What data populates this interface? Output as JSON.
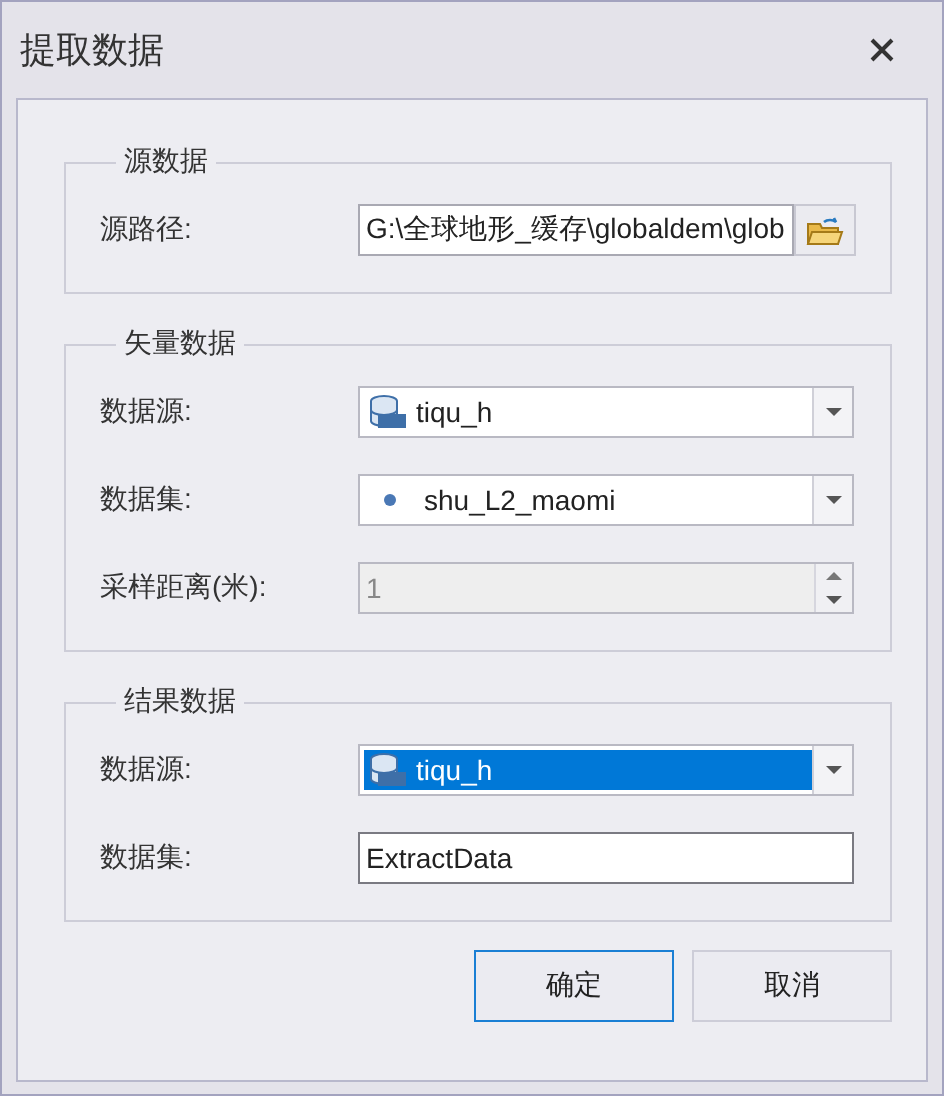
{
  "window": {
    "title": "提取数据"
  },
  "groups": [
    {
      "title": "源数据",
      "rows": [
        {
          "kind": "path",
          "label": "源路径:",
          "value": "G:\\全球地形_缓存\\globaldem\\glob"
        }
      ]
    },
    {
      "title": "矢量数据",
      "rows": [
        {
          "kind": "source",
          "label": "数据源:",
          "value": "tiqu_h",
          "highlighted": false
        },
        {
          "kind": "dataset",
          "label": "数据集:",
          "value": "shu_L2_maomi",
          "highlighted": false
        },
        {
          "kind": "spin",
          "label": "采样距离(米):",
          "value": "1",
          "disabled": true
        }
      ]
    },
    {
      "title": "结果数据",
      "rows": [
        {
          "kind": "source",
          "label": "数据源:",
          "value": "tiqu_h",
          "highlighted": true
        },
        {
          "kind": "text",
          "label": "数据集:",
          "value": "ExtractData"
        }
      ]
    }
  ],
  "buttons": [
    {
      "label": "确定",
      "default": true
    },
    {
      "label": "取消",
      "default": false
    }
  ]
}
